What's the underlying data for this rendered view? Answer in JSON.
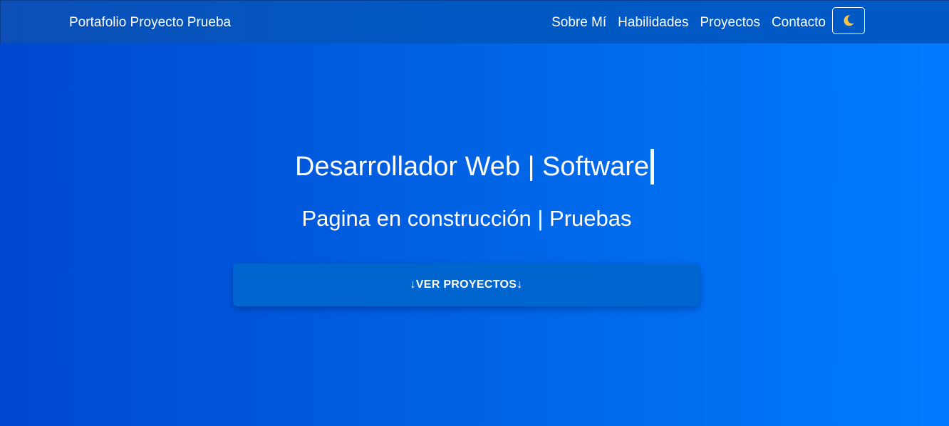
{
  "navbar": {
    "brand": "Portafolio Proyecto Prueba",
    "links": [
      {
        "label": "Sobre Mí"
      },
      {
        "label": "Habilidades"
      },
      {
        "label": "Proyectos"
      },
      {
        "label": "Contacto"
      }
    ],
    "theme_toggle": {
      "icon": "moon-icon",
      "icon_color": "#f6c343"
    }
  },
  "hero": {
    "title": "Desarrollador Web | Software",
    "subtitle": "Pagina en construcción | Pruebas",
    "cta_label": "↓VER PROYECTOS↓"
  },
  "colors": {
    "gradient_start": "#0047d1",
    "gradient_end": "#007bff",
    "navbar": "#0059c3",
    "button": "#0065ce",
    "text": "#ffffff"
  }
}
